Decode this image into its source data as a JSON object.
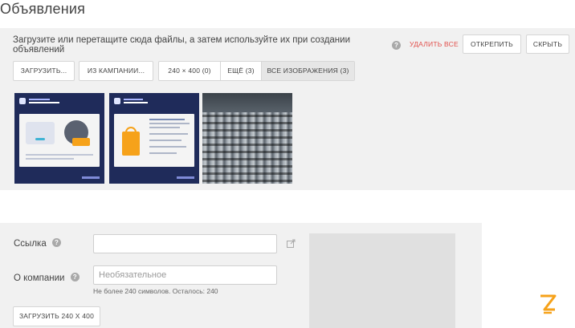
{
  "page": {
    "title": "Объявления"
  },
  "upload_panel": {
    "hint": "Загрузите или перетащите сюда файлы, а затем используйте их при создании объявлений",
    "delete_all": "УДАЛИТЬ ВСЕ",
    "unpin": "ОТКРЕПИТЬ",
    "hide": "СКРЫТЬ",
    "upload": "ЗАГРУЗИТЬ...",
    "from_campaign": "ИЗ КАМПАНИИ...",
    "filters": [
      {
        "label": "240 × 400 (0)",
        "active": false
      },
      {
        "label": "ЕЩЁ (3)",
        "active": false
      },
      {
        "label": "ВСЕ ИЗОБРАЖЕНИЯ (3)",
        "active": true
      }
    ]
  },
  "form": {
    "link_label": "Ссылка",
    "link_value": "",
    "company_label": "О компании",
    "company_placeholder": "Необязательное",
    "char_counter": "Не более 240 символов. Осталось: 240",
    "upload_size_button": "ЗАГРУЗИТЬ 240 Х 400"
  },
  "colors": {
    "accent_red": "#e2504c",
    "panel_bg": "#f1f1f1",
    "brand_orange": "#f6a21a"
  },
  "icons": {
    "help": "question-circle-icon",
    "external": "external-link-icon",
    "brand": "brand-logo-z"
  }
}
